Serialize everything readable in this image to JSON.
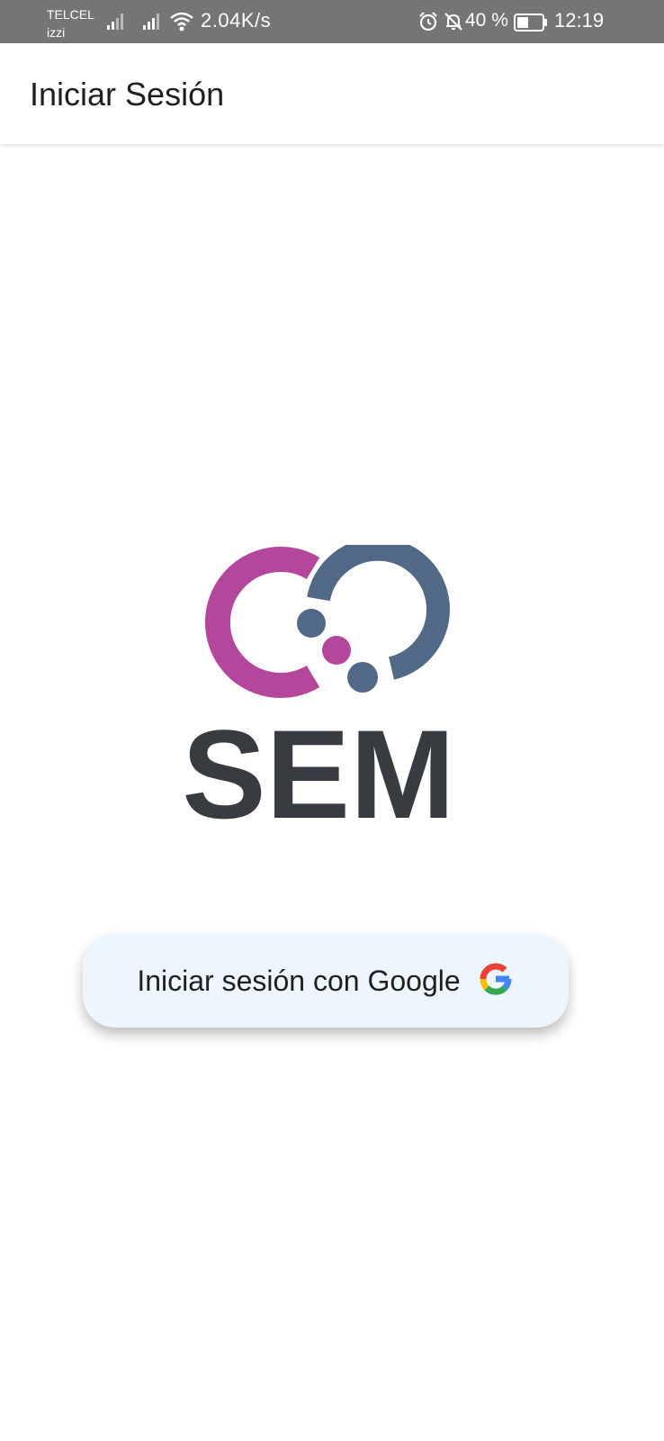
{
  "status_bar": {
    "carrier_primary": "TELCEL",
    "carrier_secondary": "izzi",
    "net_speed": "2.04K/s",
    "battery_percent": "40 %",
    "time": "12:19",
    "icons": [
      "signal-icon",
      "wifi-icon",
      "alarm-icon",
      "notifications-off-icon",
      "battery-icon"
    ]
  },
  "app_bar": {
    "title": "Iniciar Sesión"
  },
  "logo": {
    "text": "SEM",
    "colors": {
      "magenta": "#b2479b",
      "slate": "#526887",
      "text": "#383b40"
    }
  },
  "google_button": {
    "label": "Iniciar sesión con Google",
    "icon": "google-g-icon",
    "background": "#edf5fd"
  }
}
